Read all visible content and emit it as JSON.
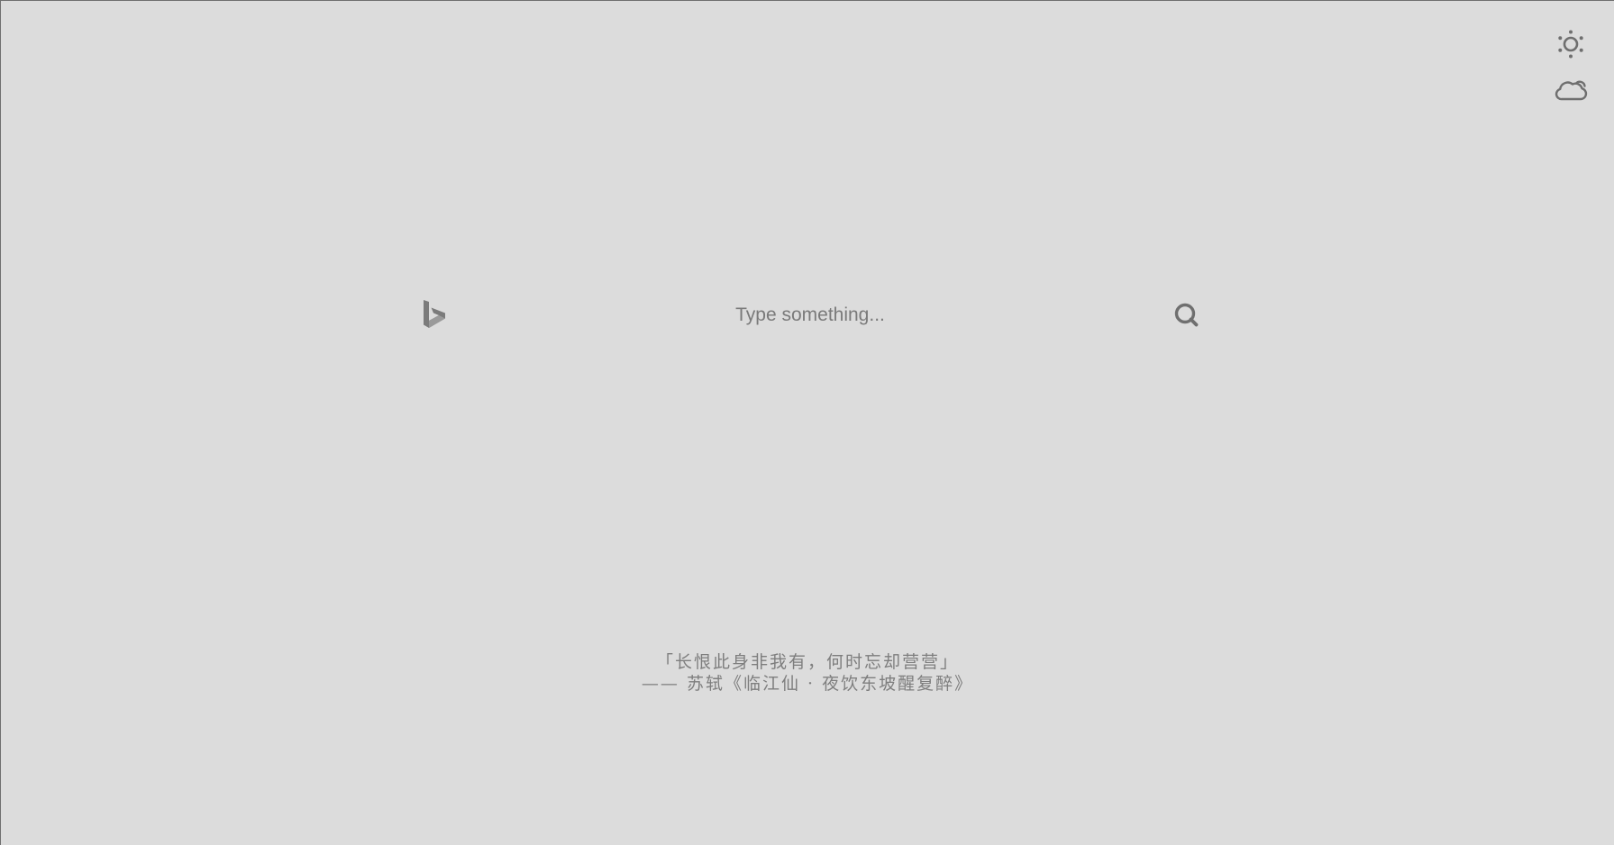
{
  "corner_controls": {
    "theme_icon": "sun-icon",
    "weather_icon": "cloud-icon"
  },
  "search": {
    "engine_icon": "bing-icon",
    "placeholder": "Type something...",
    "value": "",
    "button_icon": "search-icon"
  },
  "quote": {
    "text": "「长恨此身非我有，何时忘却营营」",
    "source": "—— 苏轼《临江仙 · 夜饮东坡醒复醉》"
  },
  "colors": {
    "background": "#dcdcdc",
    "icon": "#6f6f6f",
    "quote_text": "#7e7e7e"
  }
}
